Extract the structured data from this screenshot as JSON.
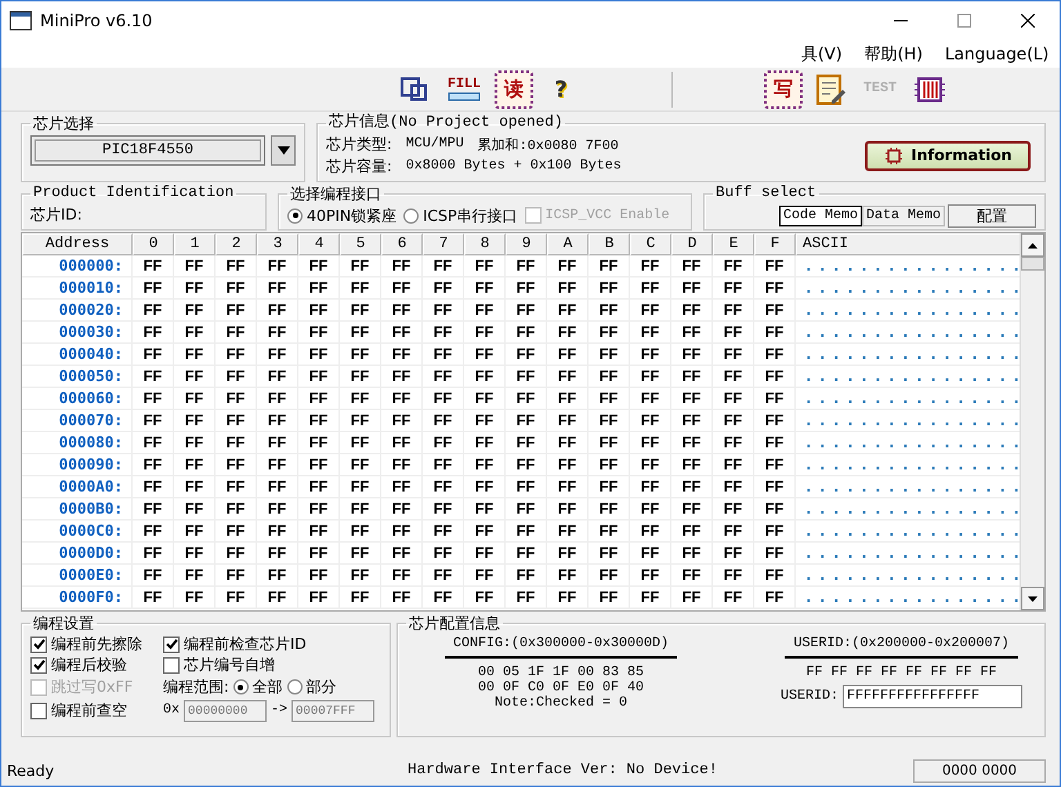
{
  "window": {
    "title": "MiniPro v6.10"
  },
  "menu": [
    {
      "label": "具(V)"
    },
    {
      "label": "帮助(H)"
    },
    {
      "label": "Language(L)"
    }
  ],
  "toolbar": [
    {
      "kind": "window"
    },
    {
      "kind": "fill",
      "label": "FILL"
    },
    {
      "kind": "chip",
      "label": "读"
    },
    {
      "kind": "help",
      "label": "?"
    },
    {
      "kind": "sep"
    },
    {
      "kind": "chip",
      "label": "写"
    },
    {
      "kind": "edit"
    },
    {
      "kind": "test",
      "label": "TEST",
      "disabled": true
    },
    {
      "kind": "ic"
    }
  ],
  "chip_select": {
    "title": "芯片选择",
    "value": "PIC18F4550"
  },
  "chip_info": {
    "title": "芯片信息(No Project opened)",
    "type_label": "芯片类型:",
    "type_value": "MCU/MPU",
    "checksum": "累加和:0x0080 7F00",
    "size_label": "芯片容量:",
    "size_value": "0x8000 Bytes + 0x100 Bytes",
    "button": "Information"
  },
  "product_id": {
    "title": "Product Identification",
    "label": "芯片ID:"
  },
  "interface": {
    "title": "选择编程接口",
    "options": [
      {
        "label": "40PIN锁紧座",
        "selected": true
      },
      {
        "label": "ICSP串行接口",
        "selected": false
      }
    ],
    "vcc": {
      "label": "ICSP_VCC Enable",
      "checked": false,
      "disabled": true
    }
  },
  "buff_select": {
    "title": "Buff select",
    "tabs": [
      {
        "label": "Code Memo",
        "selected": true
      },
      {
        "label": "Data Memo",
        "selected": false
      }
    ],
    "button": "配置"
  },
  "table": {
    "columns": [
      "Address",
      "0",
      "1",
      "2",
      "3",
      "4",
      "5",
      "6",
      "7",
      "8",
      "9",
      "A",
      "B",
      "C",
      "D",
      "E",
      "F",
      "ASCII"
    ],
    "rows": [
      {
        "cells": [
          "000000:",
          "FF",
          "FF",
          "FF",
          "FF",
          "FF",
          "FF",
          "FF",
          "FF",
          "FF",
          "FF",
          "FF",
          "FF",
          "FF",
          "FF",
          "FF",
          "FF",
          "................"
        ]
      },
      {
        "cells": [
          "000010:",
          "FF",
          "FF",
          "FF",
          "FF",
          "FF",
          "FF",
          "FF",
          "FF",
          "FF",
          "FF",
          "FF",
          "FF",
          "FF",
          "FF",
          "FF",
          "FF",
          "................"
        ]
      },
      {
        "cells": [
          "000020:",
          "FF",
          "FF",
          "FF",
          "FF",
          "FF",
          "FF",
          "FF",
          "FF",
          "FF",
          "FF",
          "FF",
          "FF",
          "FF",
          "FF",
          "FF",
          "FF",
          "................"
        ]
      },
      {
        "cells": [
          "000030:",
          "FF",
          "FF",
          "FF",
          "FF",
          "FF",
          "FF",
          "FF",
          "FF",
          "FF",
          "FF",
          "FF",
          "FF",
          "FF",
          "FF",
          "FF",
          "FF",
          "................"
        ]
      },
      {
        "cells": [
          "000040:",
          "FF",
          "FF",
          "FF",
          "FF",
          "FF",
          "FF",
          "FF",
          "FF",
          "FF",
          "FF",
          "FF",
          "FF",
          "FF",
          "FF",
          "FF",
          "FF",
          "................"
        ]
      },
      {
        "cells": [
          "000050:",
          "FF",
          "FF",
          "FF",
          "FF",
          "FF",
          "FF",
          "FF",
          "FF",
          "FF",
          "FF",
          "FF",
          "FF",
          "FF",
          "FF",
          "FF",
          "FF",
          "................"
        ]
      },
      {
        "cells": [
          "000060:",
          "FF",
          "FF",
          "FF",
          "FF",
          "FF",
          "FF",
          "FF",
          "FF",
          "FF",
          "FF",
          "FF",
          "FF",
          "FF",
          "FF",
          "FF",
          "FF",
          "................"
        ]
      },
      {
        "cells": [
          "000070:",
          "FF",
          "FF",
          "FF",
          "FF",
          "FF",
          "FF",
          "FF",
          "FF",
          "FF",
          "FF",
          "FF",
          "FF",
          "FF",
          "FF",
          "FF",
          "FF",
          "................"
        ]
      },
      {
        "cells": [
          "000080:",
          "FF",
          "FF",
          "FF",
          "FF",
          "FF",
          "FF",
          "FF",
          "FF",
          "FF",
          "FF",
          "FF",
          "FF",
          "FF",
          "FF",
          "FF",
          "FF",
          "................"
        ]
      },
      {
        "cells": [
          "000090:",
          "FF",
          "FF",
          "FF",
          "FF",
          "FF",
          "FF",
          "FF",
          "FF",
          "FF",
          "FF",
          "FF",
          "FF",
          "FF",
          "FF",
          "FF",
          "FF",
          "................"
        ]
      },
      {
        "cells": [
          "0000A0:",
          "FF",
          "FF",
          "FF",
          "FF",
          "FF",
          "FF",
          "FF",
          "FF",
          "FF",
          "FF",
          "FF",
          "FF",
          "FF",
          "FF",
          "FF",
          "FF",
          "................"
        ]
      },
      {
        "cells": [
          "0000B0:",
          "FF",
          "FF",
          "FF",
          "FF",
          "FF",
          "FF",
          "FF",
          "FF",
          "FF",
          "FF",
          "FF",
          "FF",
          "FF",
          "FF",
          "FF",
          "FF",
          "................"
        ]
      },
      {
        "cells": [
          "0000C0:",
          "FF",
          "FF",
          "FF",
          "FF",
          "FF",
          "FF",
          "FF",
          "FF",
          "FF",
          "FF",
          "FF",
          "FF",
          "FF",
          "FF",
          "FF",
          "FF",
          "................"
        ]
      },
      {
        "cells": [
          "0000D0:",
          "FF",
          "FF",
          "FF",
          "FF",
          "FF",
          "FF",
          "FF",
          "FF",
          "FF",
          "FF",
          "FF",
          "FF",
          "FF",
          "FF",
          "FF",
          "FF",
          "................"
        ]
      },
      {
        "cells": [
          "0000E0:",
          "FF",
          "FF",
          "FF",
          "FF",
          "FF",
          "FF",
          "FF",
          "FF",
          "FF",
          "FF",
          "FF",
          "FF",
          "FF",
          "FF",
          "FF",
          "FF",
          "................"
        ]
      },
      {
        "cells": [
          "0000F0:",
          "FF",
          "FF",
          "FF",
          "FF",
          "FF",
          "FF",
          "FF",
          "FF",
          "FF",
          "FF",
          "FF",
          "FF",
          "FF",
          "FF",
          "FF",
          "FF",
          "................"
        ]
      }
    ]
  },
  "program_settings": {
    "title": "编程设置",
    "options": [
      {
        "label": "编程前先擦除",
        "checked": true,
        "disabled": false
      },
      {
        "label": "编程前检查芯片ID",
        "checked": true,
        "disabled": false
      },
      {
        "label": "编程后校验",
        "checked": true,
        "disabled": false
      },
      {
        "label": "芯片编号自增",
        "checked": false,
        "disabled": false
      },
      {
        "label": "跳过写0xFF",
        "checked": false,
        "disabled": true
      },
      {
        "label": "编程前查空",
        "checked": false,
        "disabled": false
      }
    ],
    "range": {
      "label": "编程范围:",
      "choices": [
        {
          "label": "全部",
          "selected": true
        },
        {
          "label": "部分",
          "selected": false
        }
      ]
    },
    "address": {
      "prefix": "0x",
      "start": "00000000",
      "arrow": "->",
      "end": "00007FFF"
    }
  },
  "config_info": {
    "title": "芯片配置信息",
    "config": {
      "title": "CONFIG:(0x300000-0x30000D)",
      "lines": [
        "00 05 1F 1F 00 83 85",
        "00 0F C0 0F E0 0F 40",
        "Note:Checked = 0"
      ]
    },
    "userid": {
      "title": "USERID:(0x200000-0x200007)",
      "line": "FF FF FF FF FF FF FF FF",
      "label": "USERID:",
      "value": "FFFFFFFFFFFFFFFF"
    }
  },
  "status_bar": {
    "status": "Ready",
    "hardware": "Hardware Interface Ver: No Device!",
    "code": "0000 0000"
  }
}
